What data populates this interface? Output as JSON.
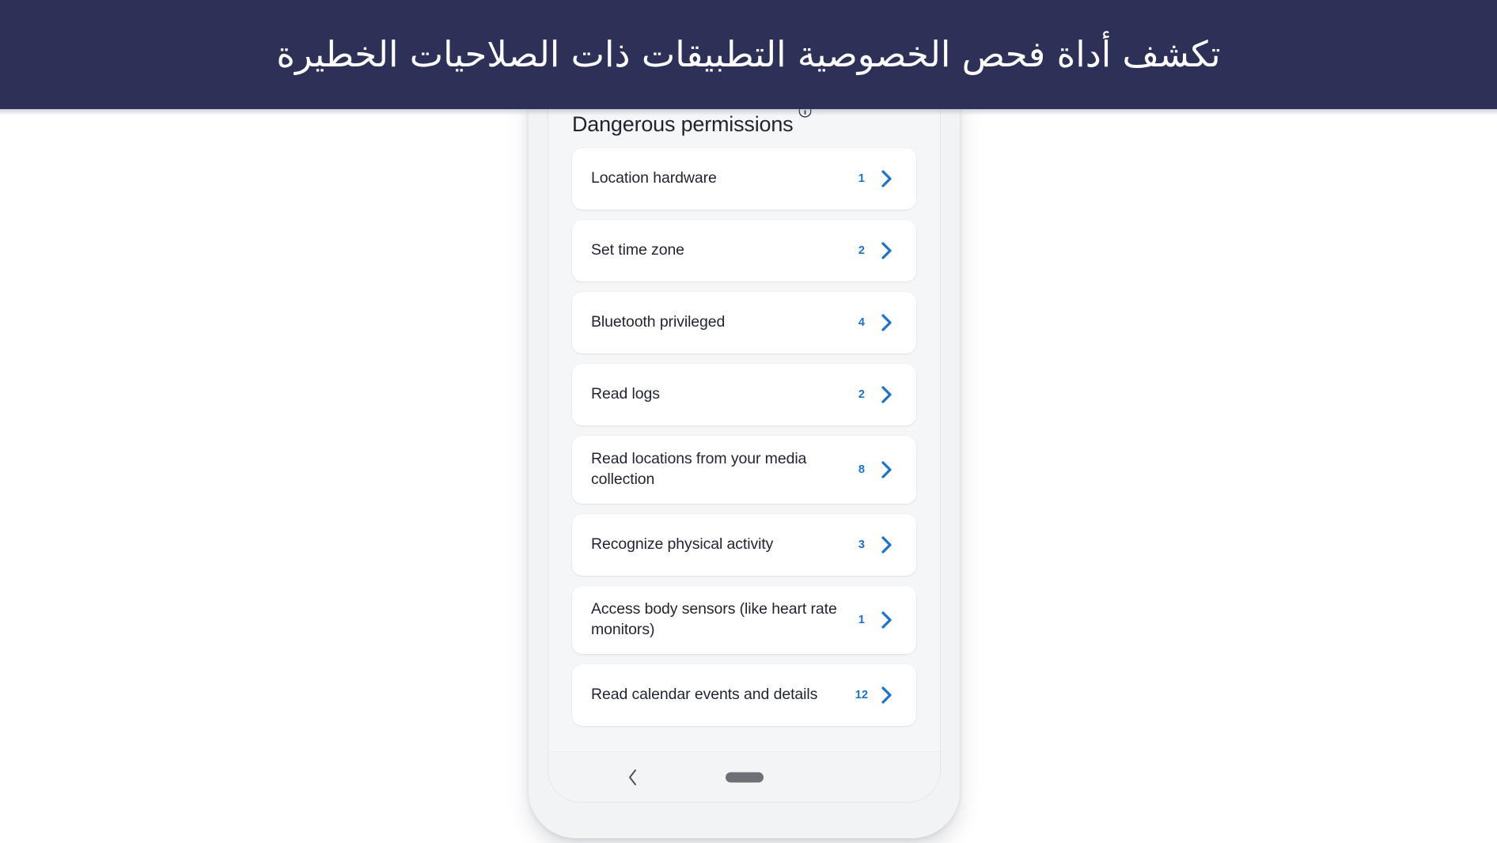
{
  "banner": {
    "title": "تكشف أداة فحص الخصوصية التطبيقات ذات الصلاحيات الخطيرة",
    "background_color": "#2e3157",
    "text_color": "#ffffff"
  },
  "screen": {
    "header": {
      "title": "Dangerous permissions",
      "info_icon": "info-circle-icon"
    },
    "accent_color": "#1a73c7",
    "background_color": "#f5f6f7",
    "permissions": [
      {
        "label": "Location hardware",
        "count": "1",
        "chevron": "chevron-right-icon"
      },
      {
        "label": "Set time zone",
        "count": "2",
        "chevron": "chevron-right-icon"
      },
      {
        "label": "Bluetooth privileged",
        "count": "4",
        "chevron": "chevron-right-icon"
      },
      {
        "label": "Read logs",
        "count": "2",
        "chevron": "chevron-right-icon"
      },
      {
        "label": "Read locations from your media collection",
        "count": "8",
        "chevron": "chevron-right-icon"
      },
      {
        "label": "Recognize physical activity",
        "count": "3",
        "chevron": "chevron-right-icon"
      },
      {
        "label": "Access body sensors (like heart rate monitors)",
        "count": "1",
        "chevron": "chevron-right-icon"
      },
      {
        "label": "Read calendar events and details",
        "count": "12",
        "chevron": "chevron-right-icon"
      }
    ],
    "nav_bar": {
      "back_icon": "chevron-left-icon",
      "home_indicator": "home-pill-indicator"
    }
  }
}
